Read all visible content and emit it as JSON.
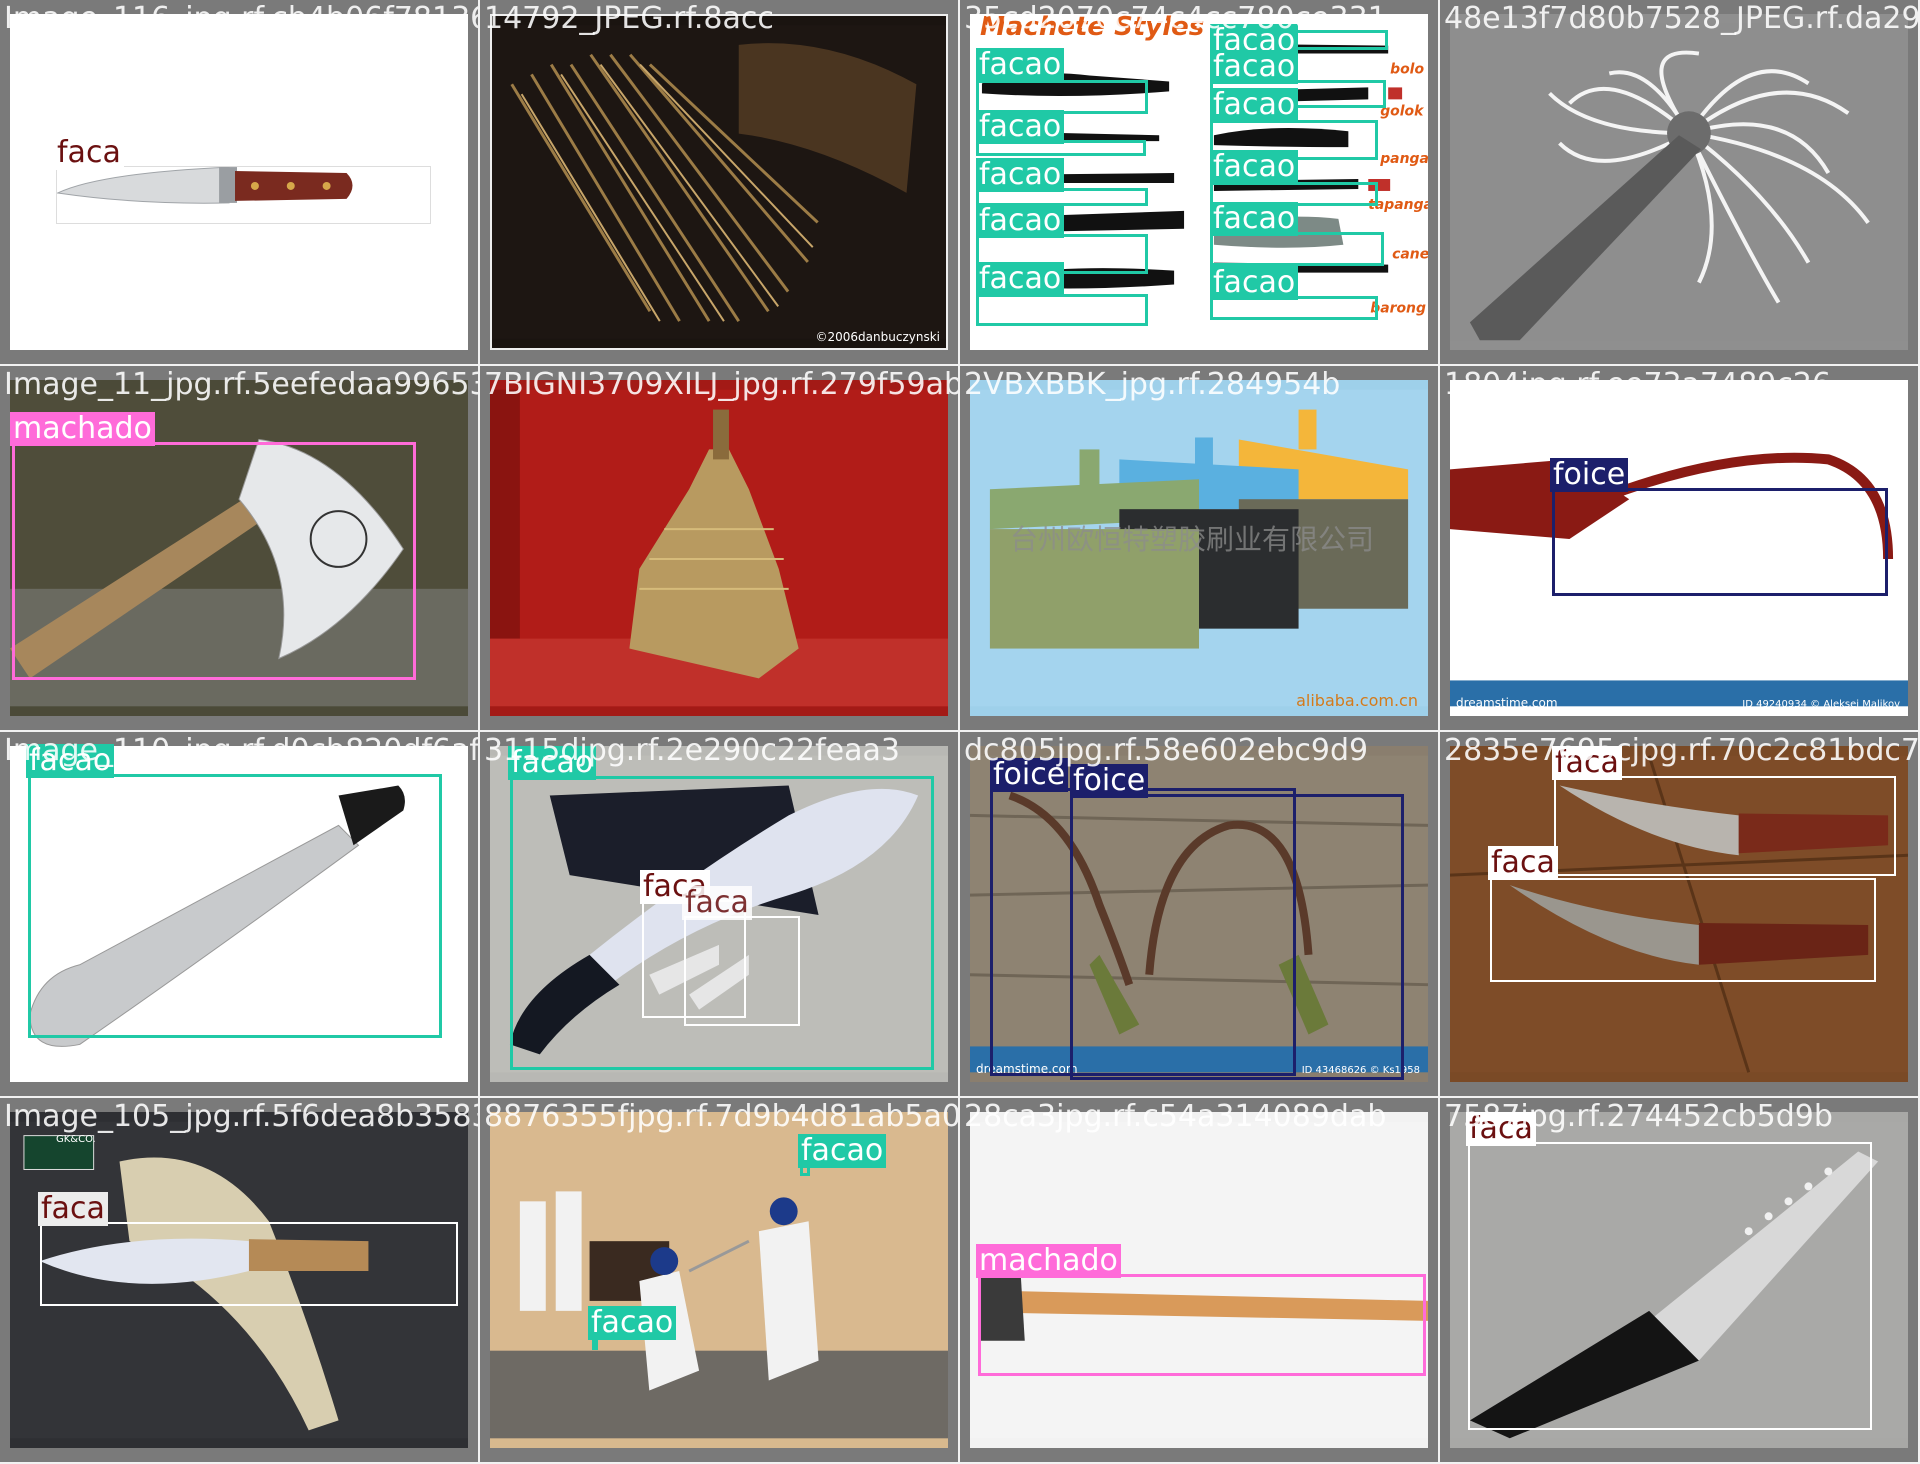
{
  "files": [
    "Image_116_jpg.rf.cb4b06f78136b55280e73ad",
    "14792_JPEG.rf.8acc",
    "35cd2070c74c4cc780ce331",
    "48e13f7d80b7528_JPEG.rf.da29",
    "Image_11_jpg.rf.5eefedaa996534",
    "7BIGNI3709XILJ_jpg.rf.279f59ab",
    "2VBXBBK_jpg.rf.284954b",
    "1804jpg.rf.ee73a7489c26",
    "Image_110_jpg.rf.d0cb820df6af5",
    "3115djpg.rf.2e290c22feaa3",
    "dc805jpg.rf.58e602ebc9d9",
    "2835e7695cjpg.rf.70c2c81bdc78",
    "Image_105_jpg.rf.5f6dea8b35832",
    "8876355fjpg.rf.7d9b4d81ab5a0",
    "28ca3jpg.rf.c54a314089dab",
    "7587jpg.rf.274452cb5d9b"
  ],
  "labels": {
    "faca": "faca",
    "facao": "facao",
    "machado": "machado",
    "foice": "foice"
  },
  "colors": {
    "faca": "#ffffff",
    "facao": "#20c9a6",
    "machado": "#ff6bd9",
    "foice": "#1c1f6b"
  },
  "watermarks": {
    "copyright": "©2006danbuczynski",
    "alibaba": "alibaba.com.cn",
    "chinese": "台州欧恒特塑胶刷业有限公司",
    "dreamstime": "dreamstime.com",
    "dreamstime_id1": "ID 49240934 © Aleksei Malikov",
    "dreamstime_id2": "ID 43468626 © Ks1958",
    "machete_title": "Machete Styles",
    "gk": "GK&CO."
  }
}
